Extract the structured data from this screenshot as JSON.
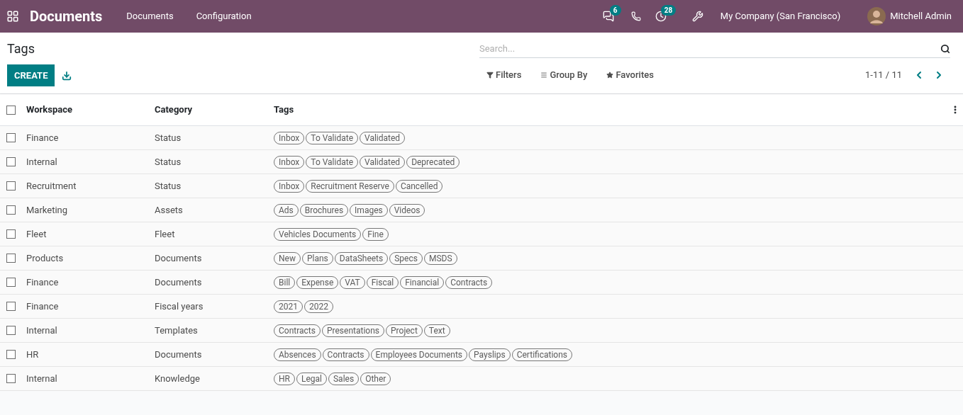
{
  "navbar": {
    "app_title": "Documents",
    "menus": [
      "Documents",
      "Configuration"
    ],
    "messages_count": "6",
    "activities_count": "28",
    "company": "My Company (San Francisco)",
    "user": "Mitchell Admin"
  },
  "control_panel": {
    "title": "Tags",
    "create_label": "CREATE",
    "search": {
      "placeholder": "Search..."
    },
    "filters": [
      "Filters",
      "Group By",
      "Favorites"
    ],
    "pager": "1-11 / 11"
  },
  "table": {
    "select_all_checked": false,
    "columns": [
      "Workspace",
      "Category",
      "Tags"
    ],
    "rows": [
      {
        "checked": false,
        "workspace": "Finance",
        "category": "Status",
        "tags": [
          "Inbox",
          "To Validate",
          "Validated"
        ]
      },
      {
        "checked": false,
        "workspace": "Internal",
        "category": "Status",
        "tags": [
          "Inbox",
          "To Validate",
          "Validated",
          "Deprecated"
        ]
      },
      {
        "checked": false,
        "workspace": "Recruitment",
        "category": "Status",
        "tags": [
          "Inbox",
          "Recruitment Reserve",
          "Cancelled"
        ]
      },
      {
        "checked": false,
        "workspace": "Marketing",
        "category": "Assets",
        "tags": [
          "Ads",
          "Brochures",
          "Images",
          "Videos"
        ]
      },
      {
        "checked": false,
        "workspace": "Fleet",
        "category": "Fleet",
        "tags": [
          "Vehicles Documents",
          "Fine"
        ]
      },
      {
        "checked": false,
        "workspace": "Products",
        "category": "Documents",
        "tags": [
          "New",
          "Plans",
          "DataSheets",
          "Specs",
          "MSDS"
        ]
      },
      {
        "checked": false,
        "workspace": "Finance",
        "category": "Documents",
        "tags": [
          "Bill",
          "Expense",
          "VAT",
          "Fiscal",
          "Financial",
          "Contracts"
        ]
      },
      {
        "checked": false,
        "workspace": "Finance",
        "category": "Fiscal years",
        "tags": [
          "2021",
          "2022"
        ]
      },
      {
        "checked": false,
        "workspace": "Internal",
        "category": "Templates",
        "tags": [
          "Contracts",
          "Presentations",
          "Project",
          "Text"
        ]
      },
      {
        "checked": false,
        "workspace": "HR",
        "category": "Documents",
        "tags": [
          "Absences",
          "Contracts",
          "Employees Documents",
          "Payslips",
          "Certifications"
        ]
      },
      {
        "checked": false,
        "workspace": "Internal",
        "category": "Knowledge",
        "tags": [
          "HR",
          "Legal",
          "Sales",
          "Other"
        ]
      }
    ]
  }
}
